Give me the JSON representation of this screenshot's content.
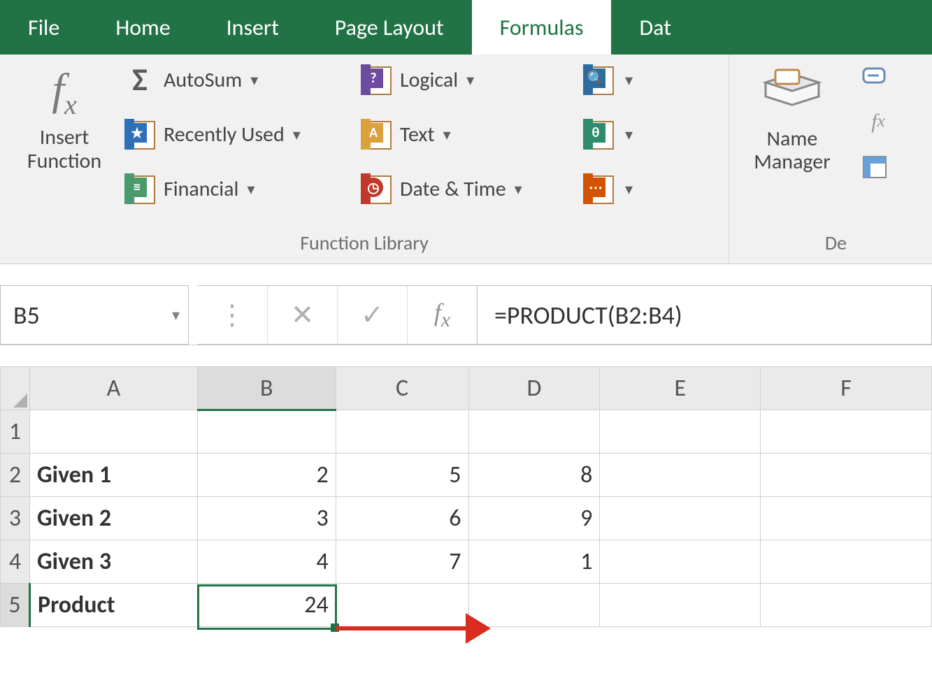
{
  "ribbon": {
    "tabs": [
      "File",
      "Home",
      "Insert",
      "Page Layout",
      "Formulas",
      "Dat"
    ],
    "active_tab": "Formulas"
  },
  "func_lib": {
    "insert_function": {
      "line1": "Insert",
      "line2": "Function"
    },
    "autosum": "AutoSum",
    "recently_used": "Recently Used",
    "financial": "Financial",
    "logical": "Logical",
    "text": "Text",
    "date_time": "Date & Time",
    "group_label": "Function Library"
  },
  "name_mgr": {
    "line1": "Name",
    "line2": "Manager",
    "group_label": "De"
  },
  "formula_bar": {
    "cell_ref": "B5",
    "formula": "=PRODUCT(B2:B4)"
  },
  "sheet": {
    "columns": [
      "A",
      "B",
      "C",
      "D",
      "E",
      "F"
    ],
    "active_col": "B",
    "active_row": "5",
    "rows": [
      {
        "n": "1",
        "cells": [
          "",
          "",
          "",
          "",
          "",
          ""
        ]
      },
      {
        "n": "2",
        "cells": [
          "Given 1",
          "2",
          "5",
          "8",
          "",
          ""
        ]
      },
      {
        "n": "3",
        "cells": [
          "Given 2",
          "3",
          "6",
          "9",
          "",
          ""
        ]
      },
      {
        "n": "4",
        "cells": [
          "Given 3",
          "4",
          "7",
          "1",
          "",
          ""
        ]
      },
      {
        "n": "5",
        "cells": [
          "Product",
          "24",
          "",
          "",
          "",
          ""
        ]
      }
    ]
  }
}
